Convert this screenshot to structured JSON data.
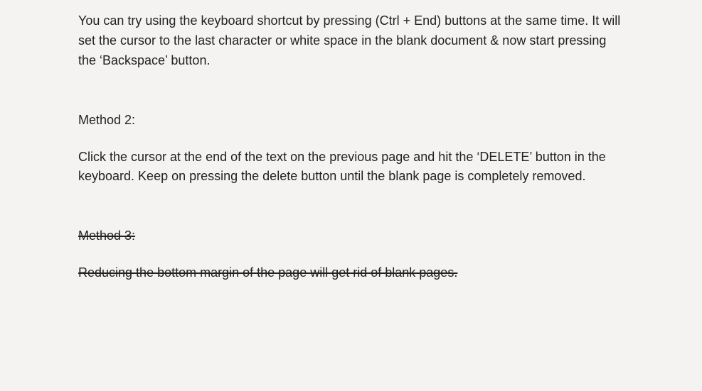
{
  "article": {
    "intro_para": "You can try using the keyboard shortcut by pressing (Ctrl + End) buttons at the same time. It will set the cursor to the last character or white space in the blank document & now start pressing the ‘Backspace’ button.",
    "method2_label": "Method 2:",
    "method2_body": "Click the cursor at the end of the text on the previous page and hit the ‘DELETE’ button in the keyboard. Keep on pressing the delete button until the blank page is completely removed.",
    "method3_label": "Method 3:",
    "method3_body": "Reducing the bottom margin of the page will get rid of blank pages."
  }
}
